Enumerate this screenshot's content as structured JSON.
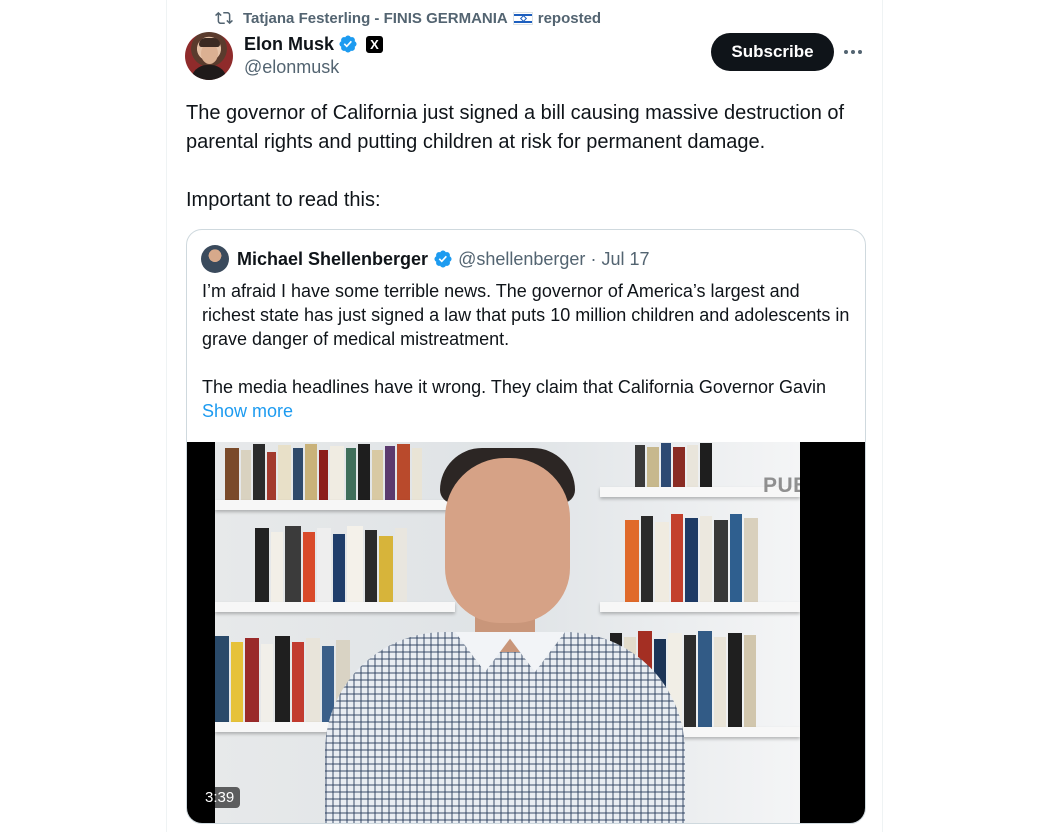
{
  "repost": {
    "icon": "repost-icon",
    "user": "Tatjana Festerling - FINIS GERMANIA",
    "flag": "israel-flag",
    "suffix": "reposted"
  },
  "author": {
    "name": "Elon Musk",
    "handle": "@elonmusk",
    "verified": true,
    "affiliate_badge": "X"
  },
  "actions": {
    "subscribe_label": "Subscribe",
    "more_icon": "more-icon"
  },
  "tweet": {
    "paragraph1": "The governor of California just signed a bill causing massive destruction of parental rights and putting children at risk for permanent damage.",
    "paragraph2": "Important to read this:"
  },
  "quote": {
    "name": "Michael Shellenberger",
    "handle": "@shellenberger",
    "separator": "·",
    "date": "Jul 17",
    "paragraph1": "I’m afraid I have some terrible news. The governor of America’s largest and richest state has just signed a law that puts 10 million children and adolescents in grave danger of medical mistreatment.",
    "paragraph2": "The media headlines have it wrong. They claim that California Governor Gavin",
    "show_more": "Show more",
    "video": {
      "watermark": "PUBLIC",
      "duration": "3:39"
    }
  },
  "colors": {
    "link": "#1d9bf0",
    "verified": "#1d9bf0",
    "secondary_text": "#536471",
    "border": "#cfd9de"
  }
}
